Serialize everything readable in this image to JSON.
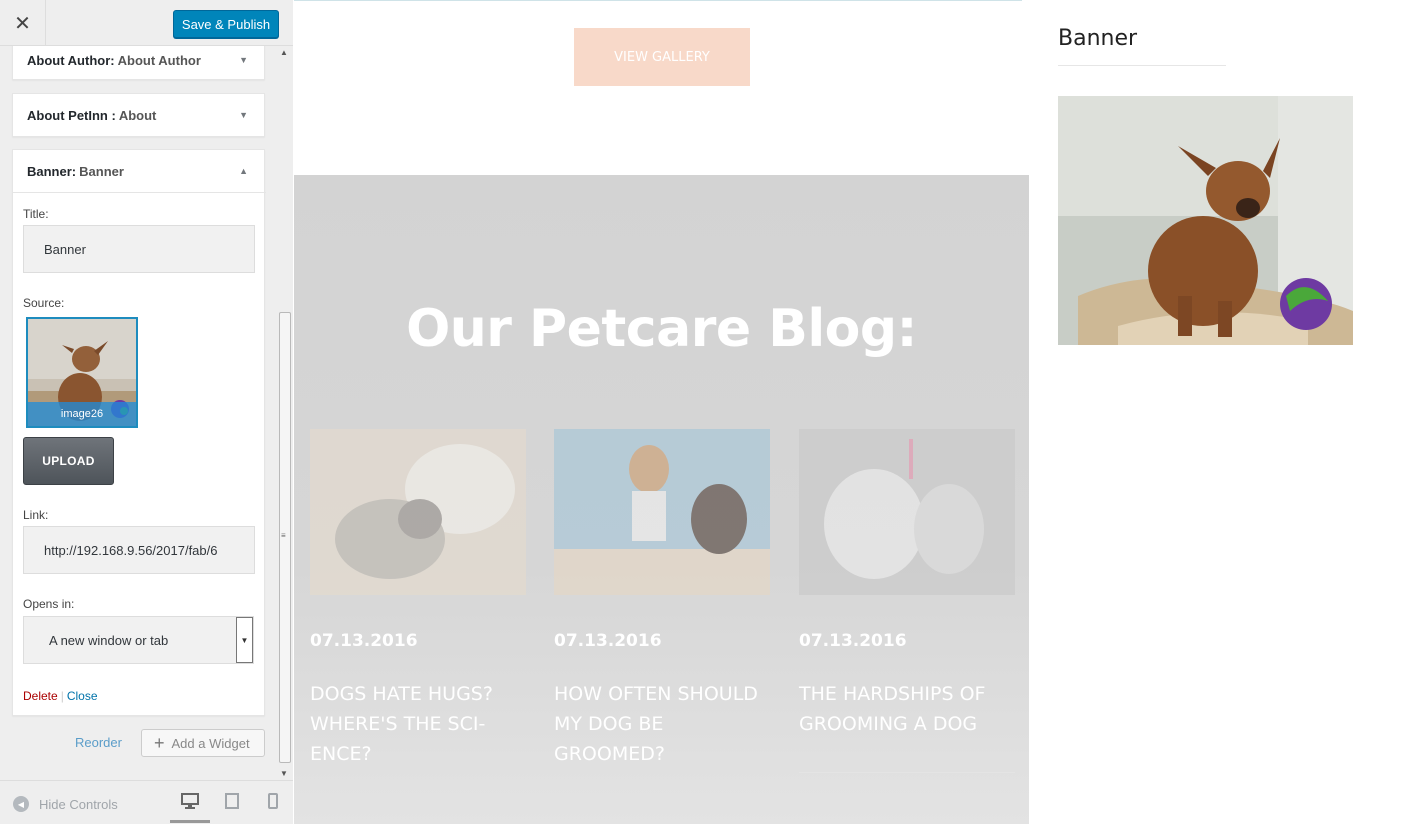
{
  "sidebar": {
    "close_glyph": "✕",
    "save_label": "Save & Publish",
    "widgets": [
      {
        "name": "About Author",
        "subtitle": "About Author",
        "sep": ":"
      },
      {
        "name": "About PetInn ",
        "subtitle": "About",
        "sep": ":"
      },
      {
        "name": "Banner",
        "subtitle": "Banner",
        "sep": ":"
      }
    ],
    "banner_form": {
      "title_label": "Title:",
      "title_value": "Banner",
      "source_label": "Source:",
      "image_caption": "image26",
      "upload_label": "UPLOAD",
      "link_label": "Link:",
      "link_value": "http://192.168.9.56/2017/fab/6",
      "opens_label": "Opens in:",
      "opens_value": "A new window or tab",
      "delete_label": "Delete",
      "separator": "|",
      "close_label": "Close"
    },
    "reorder_label": "Reorder",
    "add_widget_label": "Add a Widget",
    "hide_controls_label": "Hide Controls"
  },
  "preview": {
    "view_gallery_label": "VIEW GALLERY",
    "blog_title": "Our Petcare Blog:",
    "posts": [
      {
        "date": "07.13.2016",
        "title": "DOGS HATE HUGS? WHERE'S THE SCI-ENCE?"
      },
      {
        "date": "07.13.2016",
        "title": "HOW OFTEN SHOULD MY DOG BE GROOMED?"
      },
      {
        "date": "07.13.2016",
        "title": "THE HARDSHIPS OF GROOMING A DOG"
      }
    ],
    "widget_title": "Banner"
  },
  "colors": {
    "accent": "#0085ba",
    "link": "#0073aa",
    "danger": "#a00",
    "gallery_button": "#f8d9c9",
    "blog_bg": "#d3d3d3"
  }
}
